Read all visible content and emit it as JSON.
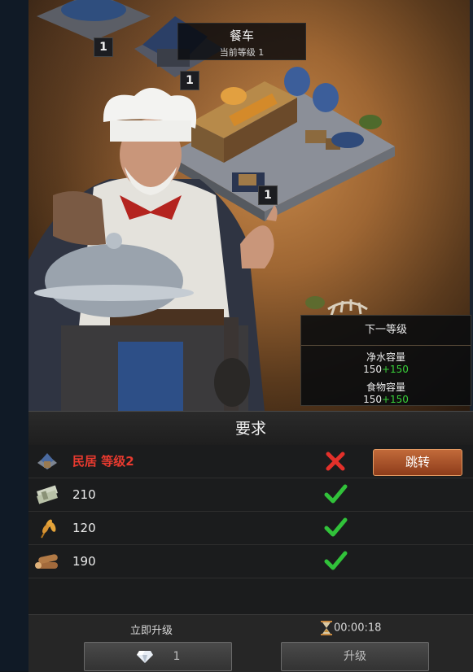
{
  "building": {
    "name": "餐车",
    "current_level": "当前等级 1"
  },
  "badges": [
    "1",
    "1",
    "1"
  ],
  "next_level": {
    "heading": "下一等级",
    "stats": [
      {
        "label": "净水容量",
        "base": "150",
        "bonus": "+150"
      },
      {
        "label": "食物容量",
        "base": "150",
        "bonus": "+150"
      }
    ]
  },
  "requirements": {
    "heading": "要求",
    "items": [
      {
        "icon": "house-icon",
        "label": "民居 等级2",
        "met": false,
        "action": "跳转"
      },
      {
        "icon": "cash-icon",
        "label": "210",
        "met": true
      },
      {
        "icon": "wheat-icon",
        "label": "120",
        "met": true
      },
      {
        "icon": "wood-icon",
        "label": "190",
        "met": true
      }
    ]
  },
  "footer": {
    "instant_label": "立即升级",
    "timer": "00:00:18",
    "instant_cost": "1",
    "upgrade_label": "升级"
  },
  "colors": {
    "accent_orange": "#b4582a",
    "bonus_green": "#39d23a",
    "fail_red": "#e83a2f"
  }
}
